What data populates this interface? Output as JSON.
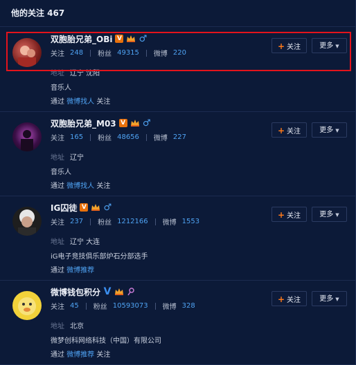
{
  "header": {
    "title": "他的关注 467"
  },
  "labels": {
    "follow_label": "关注",
    "fans_label": "粉丝",
    "weibo_label": "微博",
    "address_label": "地址",
    "via_prefix": "通过",
    "via_suffix": "关注",
    "follow_button": "关注",
    "more_button": "更多"
  },
  "users": [
    {
      "name": "双胞胎兄弟_OBi",
      "badges": [
        "v-orange-icon",
        "crown-icon",
        "male-icon"
      ],
      "follow": "248",
      "fans": "49315",
      "weibo": "220",
      "address": "辽宁 沈阳",
      "desc": "音乐人",
      "via": "微博找人"
    },
    {
      "name": "双胞胎兄弟_M03",
      "badges": [
        "v-orange-icon",
        "crown-icon",
        "male-icon"
      ],
      "follow": "165",
      "fans": "48656",
      "weibo": "227",
      "address": "辽宁",
      "desc": "音乐人",
      "via": "微博找人"
    },
    {
      "name": "IG囚徒",
      "badges": [
        "v-orange-icon",
        "crown-icon",
        "male-icon"
      ],
      "follow": "237",
      "fans": "1212166",
      "weibo": "1553",
      "address": "辽宁 大连",
      "desc": "iG电子竞技俱乐部炉石分部选手",
      "via": "微博推荐"
    },
    {
      "name": "微博钱包积分",
      "badges": [
        "v-blue-icon",
        "crown-icon",
        "female-icon"
      ],
      "follow": "45",
      "fans": "10593073",
      "weibo": "328",
      "address": "北京",
      "desc": "微梦创科网络科技（中国）有限公司",
      "via": "微博推荐"
    }
  ],
  "colors": {
    "background": "#0c1a38",
    "link": "#4fa3f3",
    "accent_orange": "#ff7a1a",
    "highlight": "#e4131c"
  }
}
